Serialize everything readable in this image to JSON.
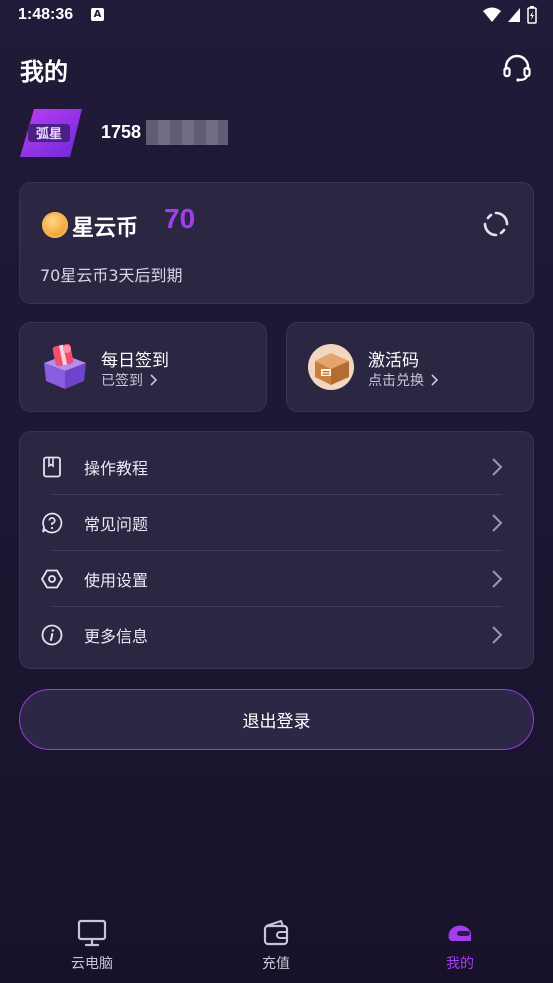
{
  "status_bar": {
    "time": "1:48:36",
    "badge": "A"
  },
  "header": {
    "title": "我的",
    "support_icon": "headset-icon"
  },
  "profile": {
    "phone_prefix": "1758",
    "avatar_text": "弧星"
  },
  "coin_card": {
    "label": "星云币",
    "amount": "70",
    "expire_note": "70星云币3天后到期",
    "refresh_icon": "refresh-icon"
  },
  "quick_cards": [
    {
      "title": "每日签到",
      "subtitle": "已签到",
      "icon": "gift-box-icon"
    },
    {
      "title": "激活码",
      "subtitle": "点击兑换",
      "icon": "package-icon"
    }
  ],
  "menu": [
    {
      "label": "操作教程",
      "icon": "book-icon"
    },
    {
      "label": "常见问题",
      "icon": "question-icon"
    },
    {
      "label": "使用设置",
      "icon": "settings-icon"
    },
    {
      "label": "更多信息",
      "icon": "info-icon"
    }
  ],
  "logout": {
    "label": "退出登录"
  },
  "tabbar": [
    {
      "label": "云电脑",
      "icon": "monitor-icon",
      "active": false
    },
    {
      "label": "充值",
      "icon": "wallet-icon",
      "active": false
    },
    {
      "label": "我的",
      "icon": "helmet-icon",
      "active": true
    }
  ],
  "colors": {
    "accent": "#a23df0",
    "card": "#2b2642",
    "background": "#1d1733"
  }
}
